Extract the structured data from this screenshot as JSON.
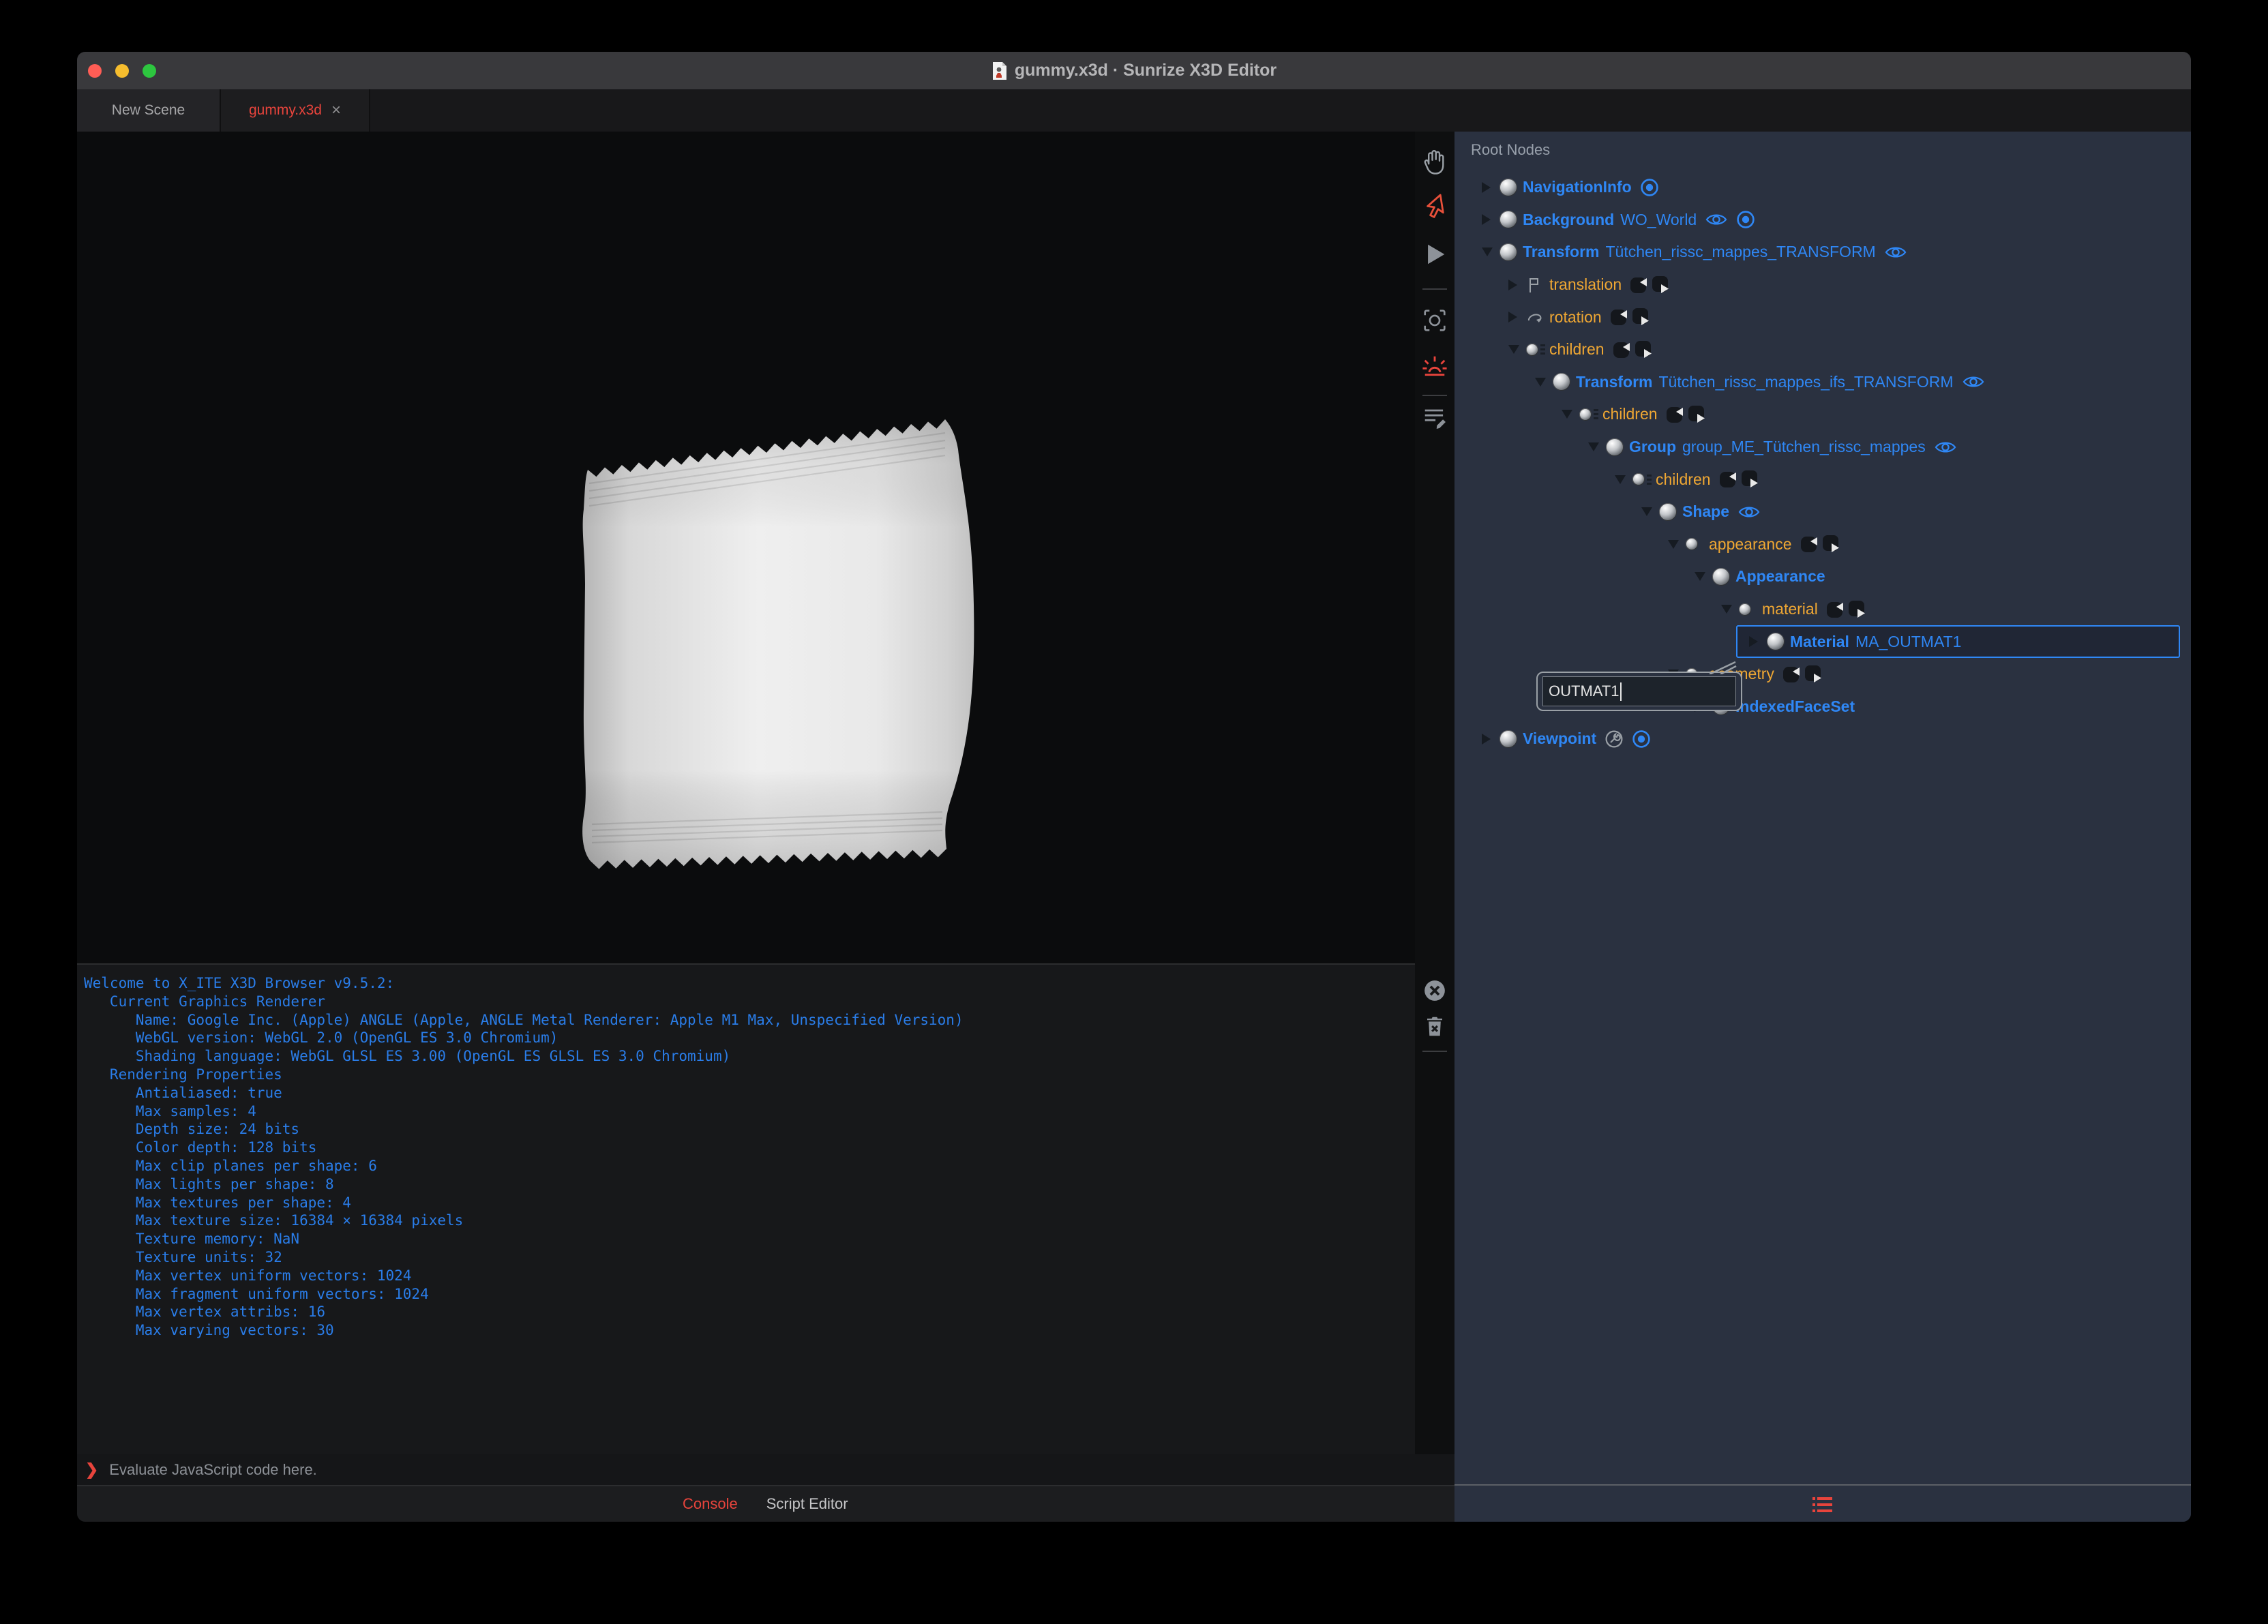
{
  "window": {
    "title": "gummy.x3d · Sunrize X3D Editor",
    "traffic_lights": [
      "close",
      "minimize",
      "zoom"
    ]
  },
  "tabs": [
    {
      "label": "New Scene",
      "active": false
    },
    {
      "label": "gummy.x3d",
      "active": true,
      "close_glyph": "×"
    }
  ],
  "side_toolbar": {
    "icons": [
      "hand",
      "select-arrow",
      "play",
      "camera-snapshot",
      "light-sun",
      "script-edit"
    ]
  },
  "console_toolbar": {
    "icons": [
      "clear-circle-x",
      "trash"
    ]
  },
  "console": {
    "lines": [
      "Welcome to X_ITE X3D Browser v9.5.2:",
      "   Current Graphics Renderer",
      "      Name: Google Inc. (Apple) ANGLE (Apple, ANGLE Metal Renderer: Apple M1 Max, Unspecified Version)",
      "      WebGL version: WebGL 2.0 (OpenGL ES 3.0 Chromium)",
      "      Shading language: WebGL GLSL ES 3.00 (OpenGL ES GLSL ES 3.0 Chromium)",
      "   Rendering Properties",
      "      Antialiased: true",
      "      Max samples: 4",
      "      Depth size: 24 bits",
      "      Color depth: 128 bits",
      "      Max clip planes per shape: 6",
      "      Max lights per shape: 8",
      "      Max textures per shape: 4",
      "      Max texture size: 16384 × 16384 pixels",
      "      Texture memory: NaN",
      "      Texture units: 32",
      "      Max vertex uniform vectors: 1024",
      "      Max fragment uniform vectors: 1024",
      "      Max vertex attribs: 16",
      "      Max varying vectors: 30"
    ],
    "prompt_chevron": "❯",
    "prompt_placeholder": "Evaluate JavaScript code here.",
    "tabs": [
      {
        "label": "Console",
        "active": true
      },
      {
        "label": "Script Editor",
        "active": false
      }
    ]
  },
  "outline": {
    "header": "Root Nodes",
    "rename_value": "OUTMAT1",
    "rows": [
      {
        "kind": "node",
        "type": "NavigationInfo",
        "name": "",
        "level": 0,
        "expanded": false,
        "icons": [
          "bind"
        ]
      },
      {
        "kind": "node",
        "type": "Background",
        "name": "WO_World",
        "level": 0,
        "expanded": false,
        "icons": [
          "eye",
          "bind"
        ]
      },
      {
        "kind": "node",
        "type": "Transform",
        "name": "Tütchen_rissc_mappes_TRANSFORM",
        "level": 0,
        "expanded": true,
        "icons": [
          "eye"
        ]
      },
      {
        "kind": "field",
        "type": "translation",
        "level": 1,
        "expanded": false,
        "field_icon": "vec3f-flag"
      },
      {
        "kind": "field",
        "type": "rotation",
        "level": 1,
        "expanded": false,
        "field_icon": "rotation"
      },
      {
        "kind": "field",
        "type": "children",
        "level": 1,
        "expanded": true,
        "field_icon": "mfnode"
      },
      {
        "kind": "node",
        "type": "Transform",
        "name": "Tütchen_rissc_mappes_ifs_TRANSFORM",
        "level": 2,
        "expanded": true,
        "icons": [
          "eye"
        ]
      },
      {
        "kind": "field",
        "type": "children",
        "level": 3,
        "expanded": true,
        "field_icon": "mfnode"
      },
      {
        "kind": "node",
        "type": "Group",
        "name": "group_ME_Tütchen_rissc_mappes",
        "level": 4,
        "expanded": true,
        "icons": [
          "eye"
        ]
      },
      {
        "kind": "field",
        "type": "children",
        "level": 5,
        "expanded": true,
        "field_icon": "mfnode"
      },
      {
        "kind": "node",
        "type": "Shape",
        "name": "",
        "level": 6,
        "expanded": true,
        "icons": [
          "eye"
        ]
      },
      {
        "kind": "field",
        "type": "appearance",
        "level": 7,
        "expanded": true,
        "field_icon": "sfnode"
      },
      {
        "kind": "node",
        "type": "Appearance",
        "name": "",
        "level": 8,
        "expanded": true,
        "icons": []
      },
      {
        "kind": "field",
        "type": "material",
        "level": 9,
        "expanded": true,
        "field_icon": "sfnode"
      },
      {
        "kind": "node",
        "type": "Material",
        "name": "MA_OUTMAT1",
        "level": 10,
        "expanded": false,
        "selected": true,
        "icons": []
      },
      {
        "kind": "field",
        "type": "geometry",
        "level": 7,
        "expanded": true,
        "field_icon": "sfnode"
      },
      {
        "kind": "node",
        "type": "IndexedFaceSet",
        "name": "",
        "level": 8,
        "expanded": false,
        "icons": []
      },
      {
        "kind": "node",
        "type": "Viewpoint",
        "name": "",
        "level": 0,
        "expanded": false,
        "icons": [
          "wrench",
          "bind"
        ]
      }
    ]
  },
  "colors": {
    "node_blue": "#2f87f5",
    "field_orange": "#efa733",
    "accent_red": "#e8443c",
    "panel_bg": "#2a3140",
    "console_text": "#2a7de9"
  }
}
